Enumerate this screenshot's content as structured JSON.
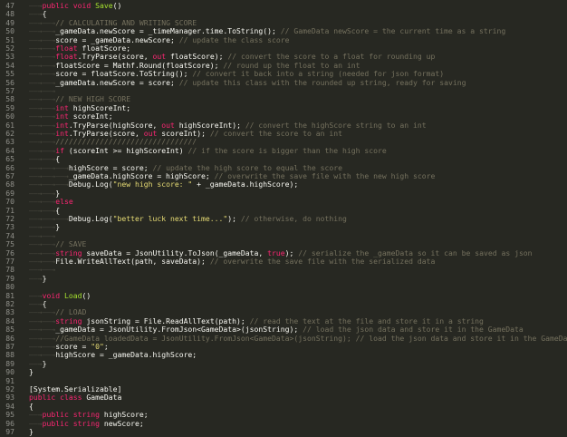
{
  "lines": [
    {
      "n": "47",
      "ws": "——→",
      "segs": [
        [
          "kw",
          "public "
        ],
        [
          "kw",
          "void "
        ],
        [
          "fn",
          "Save"
        ],
        [
          "t",
          "()"
        ]
      ]
    },
    {
      "n": "48",
      "ws": "——→",
      "segs": [
        [
          "t",
          "{"
        ]
      ]
    },
    {
      "n": "49",
      "ws": "——→——→",
      "segs": [
        [
          "cm",
          "// CALCULATING AND WRITING SCORE"
        ]
      ]
    },
    {
      "n": "50",
      "ws": "——→——→",
      "segs": [
        [
          "t",
          "_gameData.newScore = _timeManager.time.ToString(); "
        ],
        [
          "cm",
          "// GameData newScore = the current time as a string"
        ]
      ]
    },
    {
      "n": "51",
      "ws": "——→——→",
      "segs": [
        [
          "t",
          "score = _gameData.newScore; "
        ],
        [
          "cm",
          "// update the class score"
        ]
      ]
    },
    {
      "n": "52",
      "ws": "——→——→",
      "segs": [
        [
          "kw",
          "float "
        ],
        [
          "t",
          "floatScore;"
        ]
      ]
    },
    {
      "n": "53",
      "ws": "——→——→",
      "segs": [
        [
          "kw",
          "float"
        ],
        [
          "t",
          ".TryParse(score, "
        ],
        [
          "kw",
          "out "
        ],
        [
          "t",
          "floatScore); "
        ],
        [
          "cm",
          "// convert the score to a float for rounding up"
        ]
      ]
    },
    {
      "n": "54",
      "ws": "——→——→",
      "segs": [
        [
          "t",
          "floatScore = Mathf.Round(floatScore); "
        ],
        [
          "cm",
          "// round up the float to an int"
        ]
      ]
    },
    {
      "n": "55",
      "ws": "——→——→",
      "segs": [
        [
          "t",
          "score = floatScore.ToString(); "
        ],
        [
          "cm",
          "// convert it back into a string (needed for json format)"
        ]
      ]
    },
    {
      "n": "56",
      "ws": "——→——→",
      "segs": [
        [
          "t",
          "_gameData.newScore = score; "
        ],
        [
          "cm",
          "// update this class with the rounded up string, ready for saving"
        ]
      ]
    },
    {
      "n": "57",
      "ws": "——→——→",
      "segs": []
    },
    {
      "n": "58",
      "ws": "——→——→",
      "segs": [
        [
          "cm",
          "// NEW HIGH SCORE"
        ]
      ]
    },
    {
      "n": "59",
      "ws": "——→——→",
      "segs": [
        [
          "kw",
          "int "
        ],
        [
          "t",
          "highScoreInt;"
        ]
      ]
    },
    {
      "n": "60",
      "ws": "——→——→",
      "segs": [
        [
          "kw",
          "int "
        ],
        [
          "t",
          "scoreInt;"
        ]
      ]
    },
    {
      "n": "61",
      "ws": "——→——→",
      "segs": [
        [
          "kw",
          "int"
        ],
        [
          "t",
          ".TryParse(highScore, "
        ],
        [
          "kw",
          "out "
        ],
        [
          "t",
          "highScoreInt); "
        ],
        [
          "cm",
          "// convert the highScore string to an int"
        ]
      ]
    },
    {
      "n": "62",
      "ws": "——→——→",
      "segs": [
        [
          "kw",
          "int"
        ],
        [
          "t",
          ".TryParse(score, "
        ],
        [
          "kw",
          "out "
        ],
        [
          "t",
          "scoreInt); "
        ],
        [
          "cm",
          "// convert the score to an int"
        ]
      ]
    },
    {
      "n": "63",
      "ws": "——→——→",
      "segs": [
        [
          "cm",
          "////////////////////////////////"
        ]
      ]
    },
    {
      "n": "64",
      "ws": "——→——→",
      "segs": [
        [
          "kw",
          "if "
        ],
        [
          "t",
          "(scoreInt >= highScoreInt) "
        ],
        [
          "cm",
          "// if the score is bigger than the high score"
        ]
      ]
    },
    {
      "n": "65",
      "ws": "——→——→",
      "segs": [
        [
          "t",
          "{"
        ]
      ]
    },
    {
      "n": "66",
      "ws": "——→——→——→",
      "segs": [
        [
          "t",
          "highScore = score; "
        ],
        [
          "cm",
          "// update the high score to equal the score"
        ]
      ]
    },
    {
      "n": "67",
      "ws": "——→——→——→",
      "segs": [
        [
          "t",
          "_gameData.highScore = highScore; "
        ],
        [
          "cm",
          "// overwrite the save file with the new high score"
        ]
      ]
    },
    {
      "n": "68",
      "ws": "——→——→——→",
      "segs": [
        [
          "t",
          "Debug.Log("
        ],
        [
          "str",
          "\"new high score: \""
        ],
        [
          "t",
          " + _gameData.highScore);"
        ]
      ]
    },
    {
      "n": "69",
      "ws": "——→——→",
      "segs": [
        [
          "t",
          "}"
        ]
      ]
    },
    {
      "n": "70",
      "ws": "——→——→",
      "segs": [
        [
          "kw",
          "else"
        ]
      ]
    },
    {
      "n": "71",
      "ws": "——→——→",
      "segs": [
        [
          "t",
          "{"
        ]
      ]
    },
    {
      "n": "72",
      "ws": "——→——→——→",
      "segs": [
        [
          "t",
          "Debug.Log("
        ],
        [
          "str",
          "\"better luck next time...\""
        ],
        [
          "t",
          "); "
        ],
        [
          "cm",
          "// otherwise, do nothing"
        ]
      ]
    },
    {
      "n": "73",
      "ws": "——→——→",
      "segs": [
        [
          "t",
          "}"
        ]
      ]
    },
    {
      "n": "74",
      "ws": "——→——→",
      "segs": []
    },
    {
      "n": "75",
      "ws": "——→——→",
      "segs": [
        [
          "cm",
          "// SAVE"
        ]
      ]
    },
    {
      "n": "76",
      "ws": "——→——→",
      "segs": [
        [
          "kw",
          "string "
        ],
        [
          "t",
          "saveData = JsonUtility.ToJson(_gameData, "
        ],
        [
          "kw",
          "true"
        ],
        [
          "t",
          "); "
        ],
        [
          "cm",
          "// serialize the _gameData so it can be saved as json"
        ]
      ]
    },
    {
      "n": "77",
      "ws": "——→——→",
      "segs": [
        [
          "t",
          "File.WriteAllText(path, saveData); "
        ],
        [
          "cm",
          "// overwrite the save file with the serialized data"
        ]
      ]
    },
    {
      "n": "78",
      "ws": "——→——→",
      "segs": []
    },
    {
      "n": "79",
      "ws": "——→",
      "segs": [
        [
          "t",
          "}"
        ]
      ]
    },
    {
      "n": "80",
      "ws": "",
      "segs": []
    },
    {
      "n": "81",
      "ws": "——→",
      "segs": [
        [
          "kw",
          "void "
        ],
        [
          "fn",
          "Load"
        ],
        [
          "t",
          "()"
        ]
      ]
    },
    {
      "n": "82",
      "ws": "——→",
      "segs": [
        [
          "t",
          "{"
        ]
      ]
    },
    {
      "n": "83",
      "ws": "——→——→",
      "segs": [
        [
          "cm",
          "// LOAD"
        ]
      ]
    },
    {
      "n": "84",
      "ws": "——→——→",
      "segs": [
        [
          "kw",
          "string "
        ],
        [
          "t",
          "jsonString = File.ReadAllText(path); "
        ],
        [
          "cm",
          "// read the text at the file and store it in a string"
        ]
      ]
    },
    {
      "n": "85",
      "ws": "——→——→",
      "segs": [
        [
          "t",
          "_gameData = JsonUtility.FromJson<GameData>(jsonString); "
        ],
        [
          "cm",
          "// load the json data and store it in the GameData"
        ]
      ]
    },
    {
      "n": "86",
      "ws": "——→——→",
      "segs": [
        [
          "cm",
          "//GameData loadedData = JsonUtility.FromJson<GameData>(jsonString); // load the json data and store it in the GameData"
        ]
      ]
    },
    {
      "n": "87",
      "ws": "——→——→",
      "segs": [
        [
          "t",
          "score = "
        ],
        [
          "str",
          "\"0\""
        ],
        [
          "t",
          ";"
        ]
      ]
    },
    {
      "n": "88",
      "ws": "——→——→",
      "segs": [
        [
          "t",
          "highScore = _gameData.highScore;"
        ]
      ]
    },
    {
      "n": "89",
      "ws": "——→",
      "segs": [
        [
          "t",
          "}"
        ]
      ]
    },
    {
      "n": "90",
      "ws": "",
      "segs": [
        [
          "t",
          "}"
        ]
      ]
    },
    {
      "n": "91",
      "ws": "",
      "segs": []
    },
    {
      "n": "92",
      "ws": "",
      "segs": [
        [
          "t",
          "[System.Serializable]"
        ]
      ]
    },
    {
      "n": "93",
      "ws": "",
      "segs": [
        [
          "kw",
          "public "
        ],
        [
          "kw",
          "class "
        ],
        [
          "t",
          "GameData"
        ]
      ]
    },
    {
      "n": "94",
      "ws": "",
      "segs": [
        [
          "t",
          "{"
        ]
      ]
    },
    {
      "n": "95",
      "ws": "——→",
      "segs": [
        [
          "kw",
          "public "
        ],
        [
          "kw",
          "string "
        ],
        [
          "t",
          "highScore;"
        ]
      ]
    },
    {
      "n": "96",
      "ws": "——→",
      "segs": [
        [
          "kw",
          "public "
        ],
        [
          "kw",
          "string "
        ],
        [
          "t",
          "newScore;"
        ]
      ]
    },
    {
      "n": "97",
      "ws": "",
      "segs": [
        [
          "t",
          "}"
        ]
      ]
    }
  ]
}
